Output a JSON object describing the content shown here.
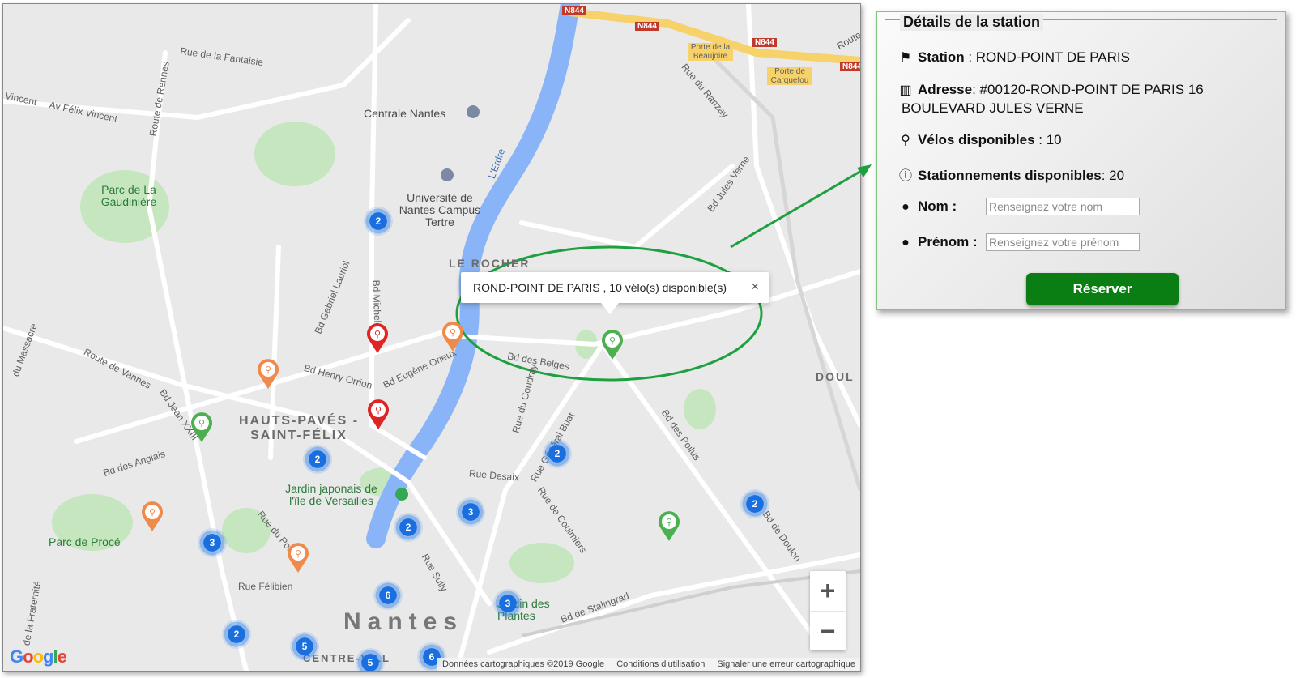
{
  "map": {
    "labels": {
      "rue_fantaisie": "Rue de la Fantaisie",
      "av_felix_vincent": "Av Félix Vincent",
      "vincent": "Vincent",
      "route_de_rennes": "Route de Rennes",
      "centrale_nantes": "Centrale Nantes",
      "universite": "Université de Nantes Campus Tertre",
      "parc_gaudiniere": "Parc de La Gaudinière",
      "lerdre": "L'Erdre",
      "le_rocher": "LE ROCHER",
      "bd_gabriel_lauriol": "Bd Gabriel Lauriol",
      "bd_michelet": "Bd Michelet",
      "du_massacre": "du Massacre",
      "route_de_vannes": "Route de Vannes",
      "bd_henry_orrion": "Bd Henry Orrion",
      "bd_eugene_orieux": "Bd Eugène Orieux",
      "bd_jean_xxiii": "Bd Jean XXIII",
      "hauts_paves": "HAUTS-PAVÉS - SAINT-FÉLIX",
      "bd_des_anglais": "Bd des Anglais",
      "jardin_japonais": "Jardin japonais de l'île de Versailles",
      "parc_de_proce": "Parc de Procé",
      "rue_du_port": "Rue du Port",
      "rue_felibien": "Rue Félibien",
      "de_la_fraternite": "de la Fraternité",
      "nantes": "Nantes",
      "centre_ville": "CENTRE-VILL",
      "rue_desaix": "Rue Desaix",
      "rue_sully": "Rue Sully",
      "rue_du_coudray": "Rue du Coudray",
      "rue_general_buat": "Rue Général Buat",
      "rue_coulmiers": "Rue de Coulmiers",
      "jardin_des_plantes": "Jardin des Plantes",
      "bd_de_stalingrad": "Bd de Stalingrad",
      "bd_des_belges": "Bd des Belges",
      "bd_des_poilus": "Bd des Poilus",
      "bd_de_doulon": "Bd de Doulon",
      "doulon": "DOUL",
      "bd_jules_verne": "Bd Jules Verne",
      "rue_ranzay": "Rue du Ranzay",
      "n844": "N844",
      "porte_beaujoire": "Porte de la Beaujoire",
      "porte_carquefou": "Porte de Carquefou",
      "route": "Route"
    },
    "clusters": [
      "2",
      "2",
      "2",
      "3",
      "2",
      "3",
      "6",
      "3",
      "2",
      "5",
      "5",
      "6",
      "2"
    ],
    "infowindow": {
      "text": "ROND-POINT DE PARIS , 10 vélo(s) disponible(s)",
      "close": "×"
    },
    "zoom": {
      "in": "+",
      "out": "−"
    },
    "attribution": {
      "data": "Données cartographiques ©2019 Google",
      "terms": "Conditions d'utilisation",
      "report": "Signaler une erreur cartographique"
    },
    "logo": "Google"
  },
  "panel": {
    "title": "Détails de la station",
    "station_label": "Station",
    "station_value": " : ROND-POINT DE PARIS",
    "address_label": "Adresse",
    "address_value": ": #00120-ROND-POINT DE PARIS 16",
    "address_value2": "BOULEVARD JULES VERNE",
    "bikes_label": "Vélos disponibles",
    "bikes_value": " : 10",
    "parking_label": "Stationnements disponibles",
    "parking_value": ": 20",
    "nom_label": "Nom :",
    "nom_placeholder": "Renseignez votre nom",
    "prenom_label": "Prénom :",
    "prenom_placeholder": "Renseignez votre prénom",
    "reserve_button": "Réserver"
  },
  "colors": {
    "accent_green": "#0b7e13",
    "cluster_blue": "#1a6fe0",
    "pin_red": "#e02323",
    "pin_orange": "#f08a4b",
    "pin_green": "#4caf50"
  }
}
